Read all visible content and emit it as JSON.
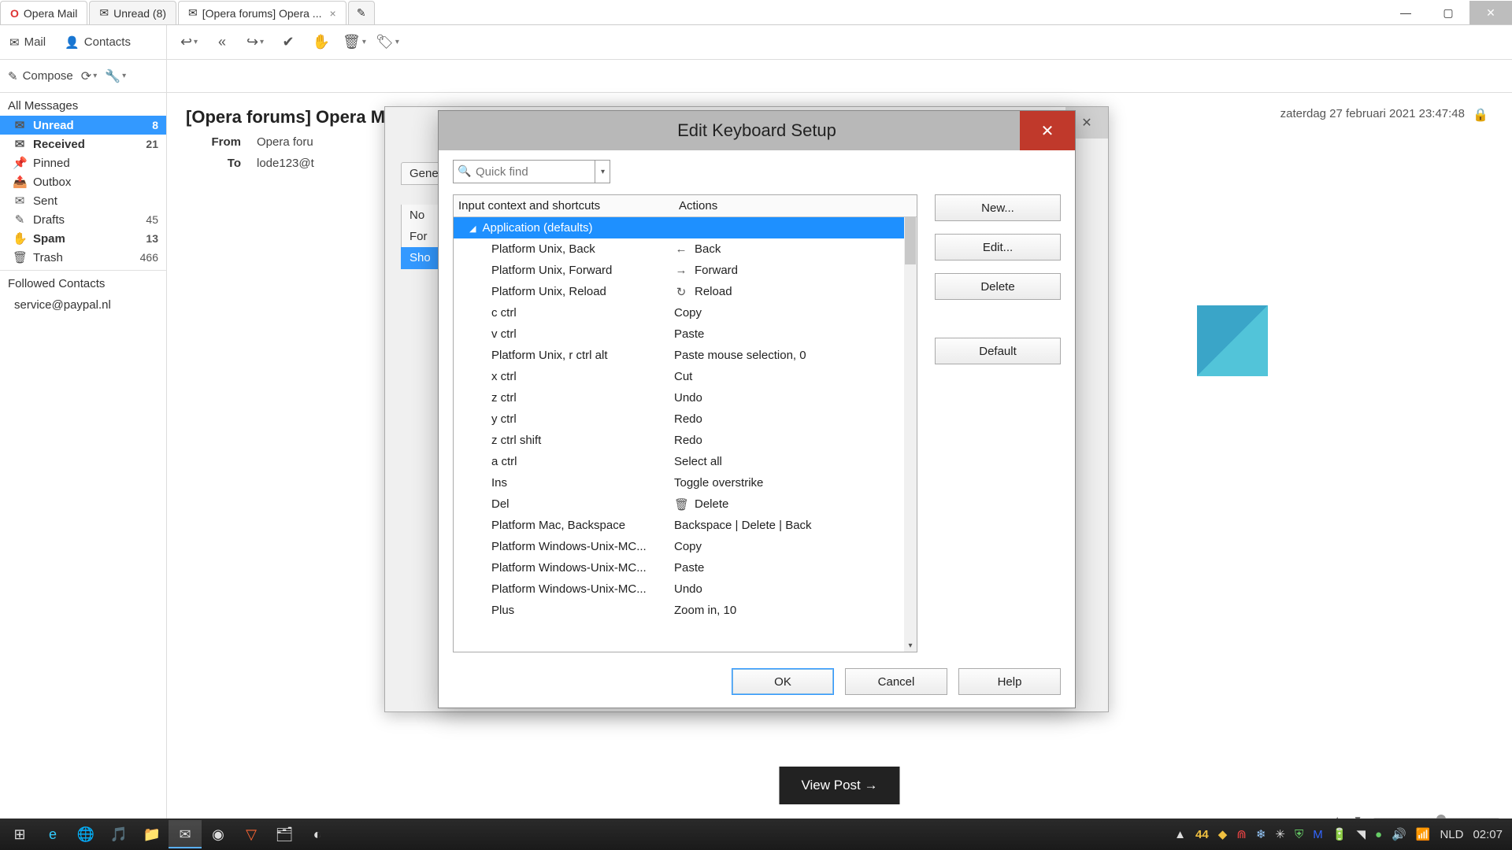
{
  "tabs": {
    "app": "Opera Mail",
    "unread": "Unread (8)",
    "forum": "[Opera forums] Opera ...",
    "new_tab_icon": "✎"
  },
  "window_controls": {
    "min": "—",
    "max": "▢",
    "close": "✕"
  },
  "toolbar": {
    "mail": "Mail",
    "contacts": "Contacts"
  },
  "subbar": {
    "compose": "Compose"
  },
  "sidebar": {
    "all": "All Messages",
    "items": [
      {
        "icon": "✉",
        "label": "Unread",
        "count": "8",
        "sel": true,
        "bold": true
      },
      {
        "icon": "✉",
        "label": "Received",
        "count": "21",
        "bold": true
      },
      {
        "icon": "📌",
        "label": "Pinned"
      },
      {
        "icon": "📤",
        "label": "Outbox"
      },
      {
        "icon": "✉",
        "label": "Sent"
      },
      {
        "icon": "✎",
        "label": "Drafts",
        "count": "45"
      },
      {
        "icon": "✋",
        "label": "Spam",
        "count": "13",
        "bold": true
      },
      {
        "icon": "🗑",
        "label": "Trash",
        "count": "466"
      }
    ],
    "followed": "Followed Contacts",
    "contact": "service@paypal.nl"
  },
  "message": {
    "subject": "[Opera forums] Opera Mail: Hotkeys For Making Heart Icon In Text",
    "date": "zaterdag 27 februari 2021 23:47:48",
    "from_label": "From",
    "from": "Opera foru",
    "to_label": "To",
    "to": "lode123@t",
    "view_post": "View Post →"
  },
  "prefs": {
    "tabs": [
      "Gene",
      "No",
      "For",
      "Sho"
    ],
    "sel_tab": 3
  },
  "dialog": {
    "title": "Edit Keyboard Setup",
    "search_placeholder": "Quick find",
    "col1": "Input context and shortcuts",
    "col2": "Actions",
    "group": "Application    (defaults)",
    "rows": [
      {
        "s": "Platform Unix, Back",
        "a": "Back",
        "i": "←"
      },
      {
        "s": "Platform Unix, Forward",
        "a": "Forward",
        "i": "→"
      },
      {
        "s": "Platform Unix, Reload",
        "a": "Reload",
        "i": "↻"
      },
      {
        "s": "c ctrl",
        "a": "Copy"
      },
      {
        "s": "v ctrl",
        "a": "Paste"
      },
      {
        "s": "Platform Unix, r ctrl alt",
        "a": "Paste mouse selection, 0"
      },
      {
        "s": "x ctrl",
        "a": "Cut"
      },
      {
        "s": "z ctrl",
        "a": "Undo"
      },
      {
        "s": "y ctrl",
        "a": "Redo"
      },
      {
        "s": "z ctrl shift",
        "a": "Redo"
      },
      {
        "s": "a ctrl",
        "a": "Select all"
      },
      {
        "s": "Ins",
        "a": "Toggle overstrike"
      },
      {
        "s": "Del",
        "a": "Delete",
        "i": "🗑"
      },
      {
        "s": "Platform Mac, Backspace",
        "a": "Backspace | Delete | Back"
      },
      {
        "s": "Platform Windows-Unix-MC...",
        "a": "Copy"
      },
      {
        "s": "Platform Windows-Unix-MC...",
        "a": "Paste"
      },
      {
        "s": "Platform Windows-Unix-MC...",
        "a": "Undo"
      },
      {
        "s": "Plus",
        "a": "Zoom in, 10"
      }
    ],
    "buttons": {
      "new": "New...",
      "edit": "Edit...",
      "delete": "Delete",
      "default": "Default"
    },
    "footer": {
      "ok": "OK",
      "cancel": "Cancel",
      "help": "Help"
    }
  },
  "taskbar": {
    "temp": "44",
    "lang": "NLD",
    "clock": "02:07"
  }
}
